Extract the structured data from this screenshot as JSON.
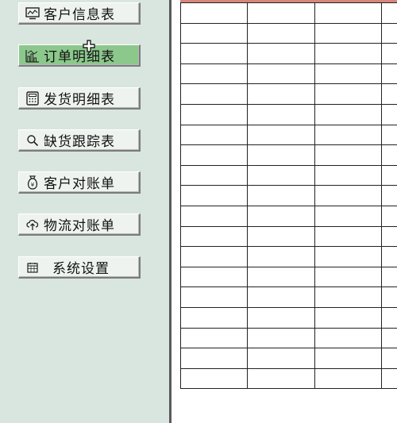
{
  "nav": {
    "items": [
      {
        "label": "客户信息表",
        "icon": "monitor-icon",
        "active": false
      },
      {
        "label": "订单明细表",
        "icon": "bar-chart-icon",
        "active": true
      },
      {
        "label": "发货明细表",
        "icon": "calculator-icon",
        "active": false
      },
      {
        "label": "缺货跟踪表",
        "icon": "search-icon",
        "active": false
      },
      {
        "label": "客户对账单",
        "icon": "money-bag-icon",
        "active": false
      },
      {
        "label": "物流对账单",
        "icon": "cloud-upload-icon",
        "active": false
      },
      {
        "label": "系统设置",
        "icon": "calendar-icon",
        "active": false
      }
    ]
  },
  "colors": {
    "sidebar_bg": "#d9e6df",
    "button_bg": "#eef3f0",
    "active_button_bg": "#8cc88c",
    "grid_header_accent": "#d8867a"
  },
  "grid": {
    "rows": 19,
    "columns": 4
  }
}
